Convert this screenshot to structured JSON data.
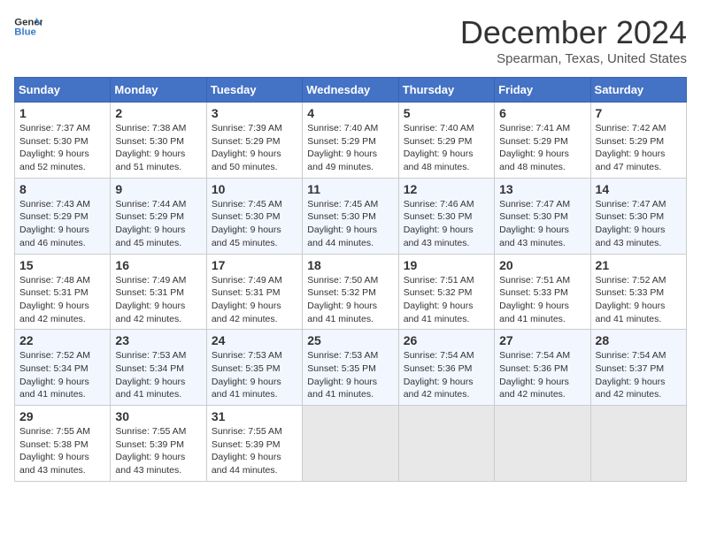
{
  "header": {
    "logo_general": "General",
    "logo_blue": "Blue",
    "month_title": "December 2024",
    "location": "Spearman, Texas, United States"
  },
  "days_of_week": [
    "Sunday",
    "Monday",
    "Tuesday",
    "Wednesday",
    "Thursday",
    "Friday",
    "Saturday"
  ],
  "weeks": [
    [
      {
        "day": "1",
        "sunrise": "7:37 AM",
        "sunset": "5:30 PM",
        "daylight": "9 hours and 52 minutes."
      },
      {
        "day": "2",
        "sunrise": "7:38 AM",
        "sunset": "5:30 PM",
        "daylight": "9 hours and 51 minutes."
      },
      {
        "day": "3",
        "sunrise": "7:39 AM",
        "sunset": "5:29 PM",
        "daylight": "9 hours and 50 minutes."
      },
      {
        "day": "4",
        "sunrise": "7:40 AM",
        "sunset": "5:29 PM",
        "daylight": "9 hours and 49 minutes."
      },
      {
        "day": "5",
        "sunrise": "7:40 AM",
        "sunset": "5:29 PM",
        "daylight": "9 hours and 48 minutes."
      },
      {
        "day": "6",
        "sunrise": "7:41 AM",
        "sunset": "5:29 PM",
        "daylight": "9 hours and 48 minutes."
      },
      {
        "day": "7",
        "sunrise": "7:42 AM",
        "sunset": "5:29 PM",
        "daylight": "9 hours and 47 minutes."
      }
    ],
    [
      {
        "day": "8",
        "sunrise": "7:43 AM",
        "sunset": "5:29 PM",
        "daylight": "9 hours and 46 minutes."
      },
      {
        "day": "9",
        "sunrise": "7:44 AM",
        "sunset": "5:29 PM",
        "daylight": "9 hours and 45 minutes."
      },
      {
        "day": "10",
        "sunrise": "7:45 AM",
        "sunset": "5:30 PM",
        "daylight": "9 hours and 45 minutes."
      },
      {
        "day": "11",
        "sunrise": "7:45 AM",
        "sunset": "5:30 PM",
        "daylight": "9 hours and 44 minutes."
      },
      {
        "day": "12",
        "sunrise": "7:46 AM",
        "sunset": "5:30 PM",
        "daylight": "9 hours and 43 minutes."
      },
      {
        "day": "13",
        "sunrise": "7:47 AM",
        "sunset": "5:30 PM",
        "daylight": "9 hours and 43 minutes."
      },
      {
        "day": "14",
        "sunrise": "7:47 AM",
        "sunset": "5:30 PM",
        "daylight": "9 hours and 43 minutes."
      }
    ],
    [
      {
        "day": "15",
        "sunrise": "7:48 AM",
        "sunset": "5:31 PM",
        "daylight": "9 hours and 42 minutes."
      },
      {
        "day": "16",
        "sunrise": "7:49 AM",
        "sunset": "5:31 PM",
        "daylight": "9 hours and 42 minutes."
      },
      {
        "day": "17",
        "sunrise": "7:49 AM",
        "sunset": "5:31 PM",
        "daylight": "9 hours and 42 minutes."
      },
      {
        "day": "18",
        "sunrise": "7:50 AM",
        "sunset": "5:32 PM",
        "daylight": "9 hours and 41 minutes."
      },
      {
        "day": "19",
        "sunrise": "7:51 AM",
        "sunset": "5:32 PM",
        "daylight": "9 hours and 41 minutes."
      },
      {
        "day": "20",
        "sunrise": "7:51 AM",
        "sunset": "5:33 PM",
        "daylight": "9 hours and 41 minutes."
      },
      {
        "day": "21",
        "sunrise": "7:52 AM",
        "sunset": "5:33 PM",
        "daylight": "9 hours and 41 minutes."
      }
    ],
    [
      {
        "day": "22",
        "sunrise": "7:52 AM",
        "sunset": "5:34 PM",
        "daylight": "9 hours and 41 minutes."
      },
      {
        "day": "23",
        "sunrise": "7:53 AM",
        "sunset": "5:34 PM",
        "daylight": "9 hours and 41 minutes."
      },
      {
        "day": "24",
        "sunrise": "7:53 AM",
        "sunset": "5:35 PM",
        "daylight": "9 hours and 41 minutes."
      },
      {
        "day": "25",
        "sunrise": "7:53 AM",
        "sunset": "5:35 PM",
        "daylight": "9 hours and 41 minutes."
      },
      {
        "day": "26",
        "sunrise": "7:54 AM",
        "sunset": "5:36 PM",
        "daylight": "9 hours and 42 minutes."
      },
      {
        "day": "27",
        "sunrise": "7:54 AM",
        "sunset": "5:36 PM",
        "daylight": "9 hours and 42 minutes."
      },
      {
        "day": "28",
        "sunrise": "7:54 AM",
        "sunset": "5:37 PM",
        "daylight": "9 hours and 42 minutes."
      }
    ],
    [
      {
        "day": "29",
        "sunrise": "7:55 AM",
        "sunset": "5:38 PM",
        "daylight": "9 hours and 43 minutes."
      },
      {
        "day": "30",
        "sunrise": "7:55 AM",
        "sunset": "5:39 PM",
        "daylight": "9 hours and 43 minutes."
      },
      {
        "day": "31",
        "sunrise": "7:55 AM",
        "sunset": "5:39 PM",
        "daylight": "9 hours and 44 minutes."
      },
      null,
      null,
      null,
      null
    ]
  ]
}
